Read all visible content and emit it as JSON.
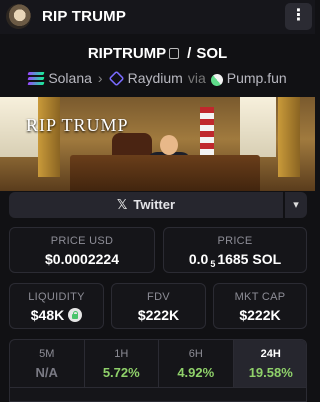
{
  "header": {
    "title": "RIP TRUMP",
    "menu_icon": "⋮"
  },
  "pair": {
    "base": "RIPTRUMP",
    "separator": "/",
    "quote": "SOL"
  },
  "meta": {
    "chain": "Solana",
    "dex": "Raydium",
    "via": "via",
    "launchpad": "Pump.fun"
  },
  "banner": {
    "text": "RIP TRUMP"
  },
  "social": {
    "twitter_label": "Twitter",
    "x_glyph": "𝕏",
    "expand_glyph": "▾"
  },
  "stats": {
    "price_usd": {
      "label": "PRICE USD",
      "value": "$0.0002224"
    },
    "price_native": {
      "label": "PRICE",
      "prefix": "0.0",
      "zeros": "5",
      "digits": "1685",
      "unit": "SOL"
    },
    "liquidity": {
      "label": "LIQUIDITY",
      "value": "$48K"
    },
    "fdv": {
      "label": "FDV",
      "value": "$222K"
    },
    "mkt_cap": {
      "label": "MKT CAP",
      "value": "$222K"
    }
  },
  "timeframes": [
    {
      "key": "5M",
      "value": "N/A",
      "color": "#7a7a84"
    },
    {
      "key": "1H",
      "value": "5.72%",
      "color": "#8fd16a"
    },
    {
      "key": "6H",
      "value": "4.92%",
      "color": "#8fd16a"
    },
    {
      "key": "24H",
      "value": "19.58%",
      "color": "#8fd16a"
    }
  ],
  "colors": {
    "accent_green": "#8fd16a",
    "background": "#111114",
    "card_border": "#2b2b33"
  }
}
